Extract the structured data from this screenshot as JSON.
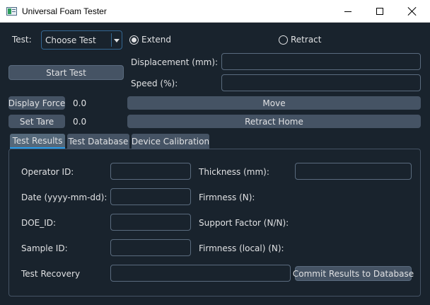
{
  "window": {
    "title": "Universal Foam Tester"
  },
  "icons": {
    "app": "app-window-icon",
    "minimize": "minimize-icon",
    "maximize": "maximize-icon",
    "close": "close-icon",
    "dropdown": "chevron-down-icon"
  },
  "controls": {
    "test_label": "Test:",
    "test_select": "Choose Test",
    "extend_label": "Extend",
    "extend_checked": true,
    "retract_label": "Retract",
    "retract_checked": false,
    "start_test": "Start Test",
    "displacement_label": "Displacement (mm):",
    "displacement_value": "",
    "speed_label": "Speed (%):",
    "speed_value": "",
    "display_force": "Display Force",
    "force_value": "0.0",
    "set_tare": "Set Tare",
    "tare_value": "0.0",
    "move": "Move",
    "retract_home": "Retract Home"
  },
  "tabs": [
    {
      "label": "Test Results",
      "active": true
    },
    {
      "label": "Test Database",
      "active": false
    },
    {
      "label": "Device Calibration",
      "active": false
    }
  ],
  "results": {
    "operator_label": "Operator ID:",
    "operator_value": "",
    "date_label": "Date (yyyy-mm-dd):",
    "date_value": "",
    "doe_label": "DOE_ID:",
    "doe_value": "",
    "sample_label": "Sample ID:",
    "sample_value": "",
    "recovery_label": "Test Recovery",
    "recovery_value": "",
    "thickness_label": "Thickness (mm):",
    "thickness_value": "",
    "firmness_label": "Firmness (N):",
    "support_label": "Support Factor (N/N):",
    "firmness_local_label": "Firmness (local) (N):",
    "commit_button": "Commit Results to Database"
  },
  "colors": {
    "background": "#19232d",
    "button": "#455364",
    "accent": "#259ae9",
    "text": "#e0e1e3"
  }
}
